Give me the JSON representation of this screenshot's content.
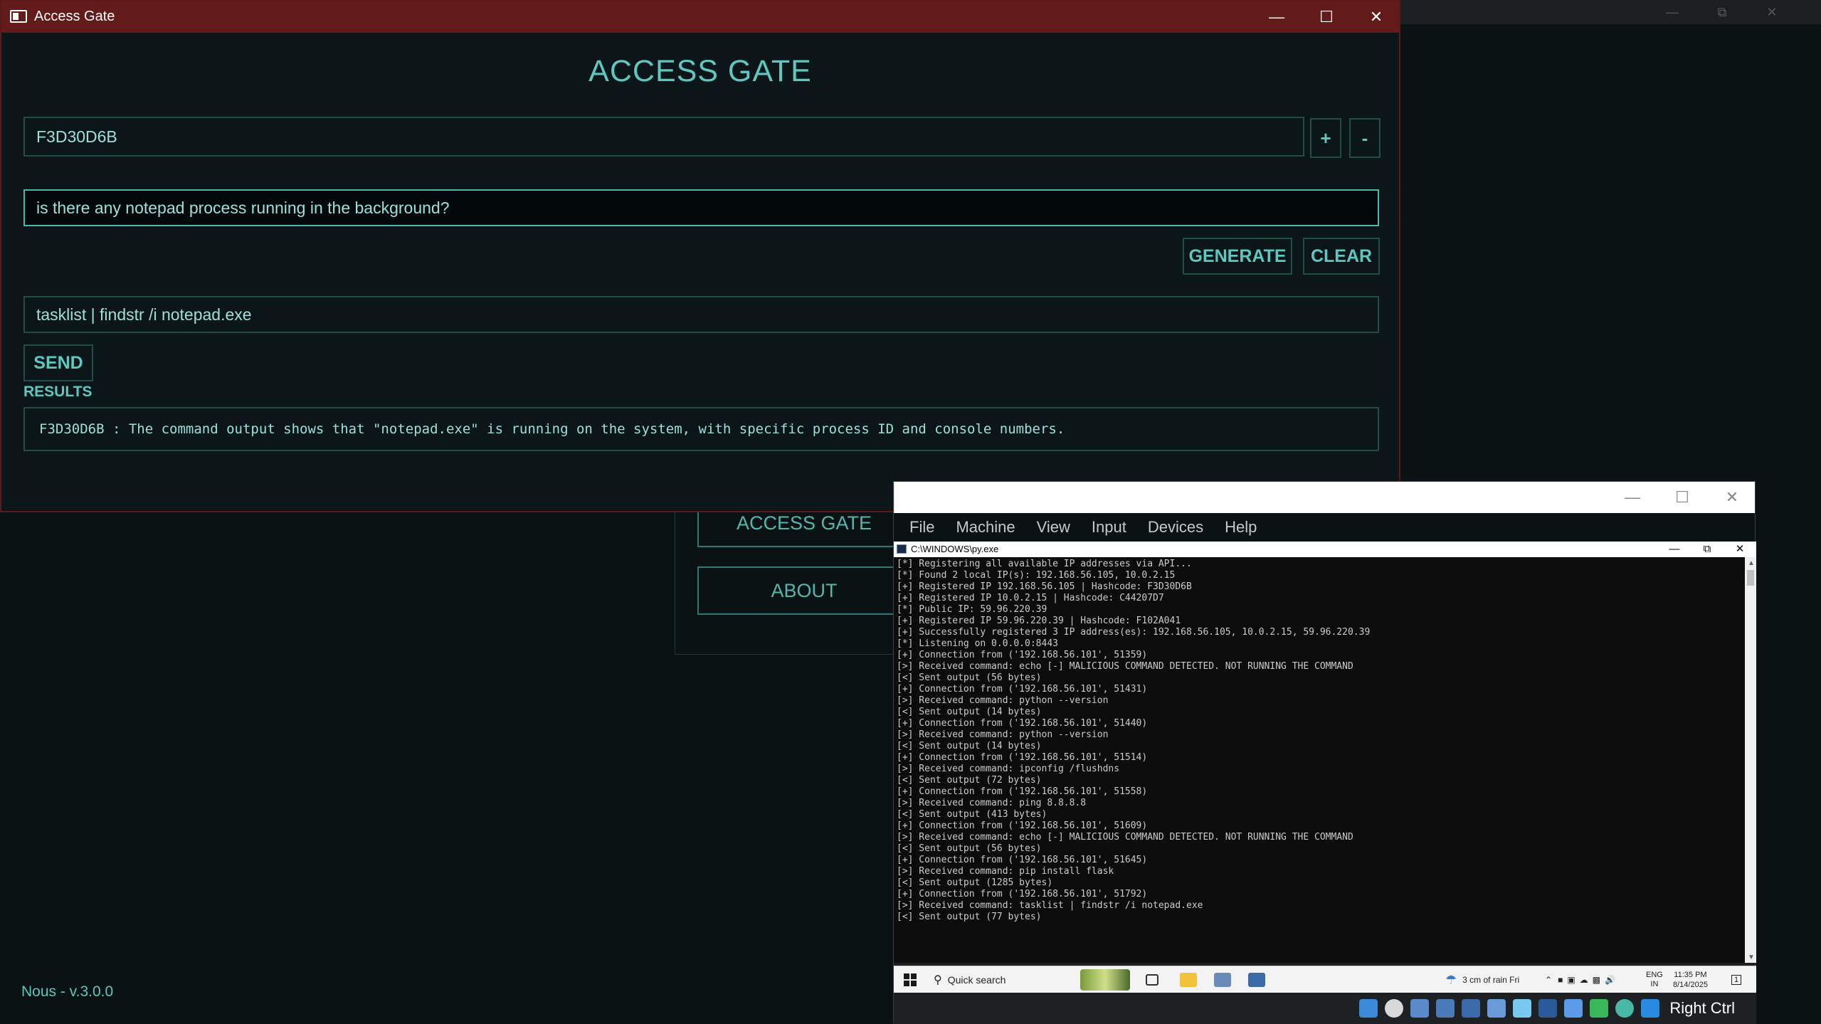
{
  "main_window": {
    "title": "Access Gate",
    "heading": "ACCESS GATE",
    "hashcode_value": "F3D30D6B",
    "add_label": "+",
    "remove_label": "-",
    "prompt_value": "is there any notepad process running in the background?",
    "generate_label": "GENERATE",
    "clear_label": "CLEAR",
    "command_value": "tasklist | findstr /i notepad.exe",
    "send_label": "SEND",
    "results_label": "RESULTS",
    "result_text": "F3D30D6B : The command output shows that \"notepad.exe\" is running on the system, with specific process ID and console numbers."
  },
  "background_app": {
    "nav_access_gate": "ACCESS GATE",
    "nav_about": "ABOUT",
    "version": "Nous - v.3.0.0"
  },
  "vbox": {
    "menu": [
      "File",
      "Machine",
      "View",
      "Input",
      "Devices",
      "Help"
    ],
    "host_key": "Right Ctrl"
  },
  "cmd": {
    "title": "C:\\WINDOWS\\py.exe",
    "lines": [
      "[*] Registering all available IP addresses via API...",
      "[*] Found 2 local IP(s): 192.168.56.105, 10.0.2.15",
      "[+] Registered IP 192.168.56.105 | Hashcode: F3D30D6B",
      "[+] Registered IP 10.0.2.15 | Hashcode: C44207D7",
      "[*] Public IP: 59.96.220.39",
      "[+] Registered IP 59.96.220.39 | Hashcode: F102A041",
      "[+] Successfully registered 3 IP address(es): 192.168.56.105, 10.0.2.15, 59.96.220.39",
      "[*] Listening on 0.0.0.0:8443",
      "[+] Connection from ('192.168.56.101', 51359)",
      "[>] Received command: echo [-] MALICIOUS COMMAND DETECTED. NOT RUNNING THE COMMAND",
      "[<] Sent output (56 bytes)",
      "[+] Connection from ('192.168.56.101', 51431)",
      "[>] Received command: python --version",
      "[<] Sent output (14 bytes)",
      "[+] Connection from ('192.168.56.101', 51440)",
      "[>] Received command: python --version",
      "[<] Sent output (14 bytes)",
      "[+] Connection from ('192.168.56.101', 51514)",
      "[>] Received command: ipconfig /flushdns",
      "[<] Sent output (72 bytes)",
      "[+] Connection from ('192.168.56.101', 51558)",
      "[>] Received command: ping 8.8.8.8",
      "[<] Sent output (413 bytes)",
      "[+] Connection from ('192.168.56.101', 51609)",
      "[>] Received command: echo [-] MALICIOUS COMMAND DETECTED. NOT RUNNING THE COMMAND",
      "[<] Sent output (56 bytes)",
      "[+] Connection from ('192.168.56.101', 51645)",
      "[>] Received command: pip install flask",
      "[<] Sent output (1285 bytes)",
      "[+] Connection from ('192.168.56.101', 51792)",
      "[>] Received command: tasklist | findstr /i notepad.exe",
      "[<] Sent output (77 bytes)"
    ]
  },
  "guest_taskbar": {
    "search_label": "Quick search",
    "weather": "3 cm of rain Fri",
    "lang_top": "ENG",
    "lang_bottom": "IN",
    "time": "11:35 PM",
    "date": "8/14/2025",
    "notification_count": "1"
  }
}
